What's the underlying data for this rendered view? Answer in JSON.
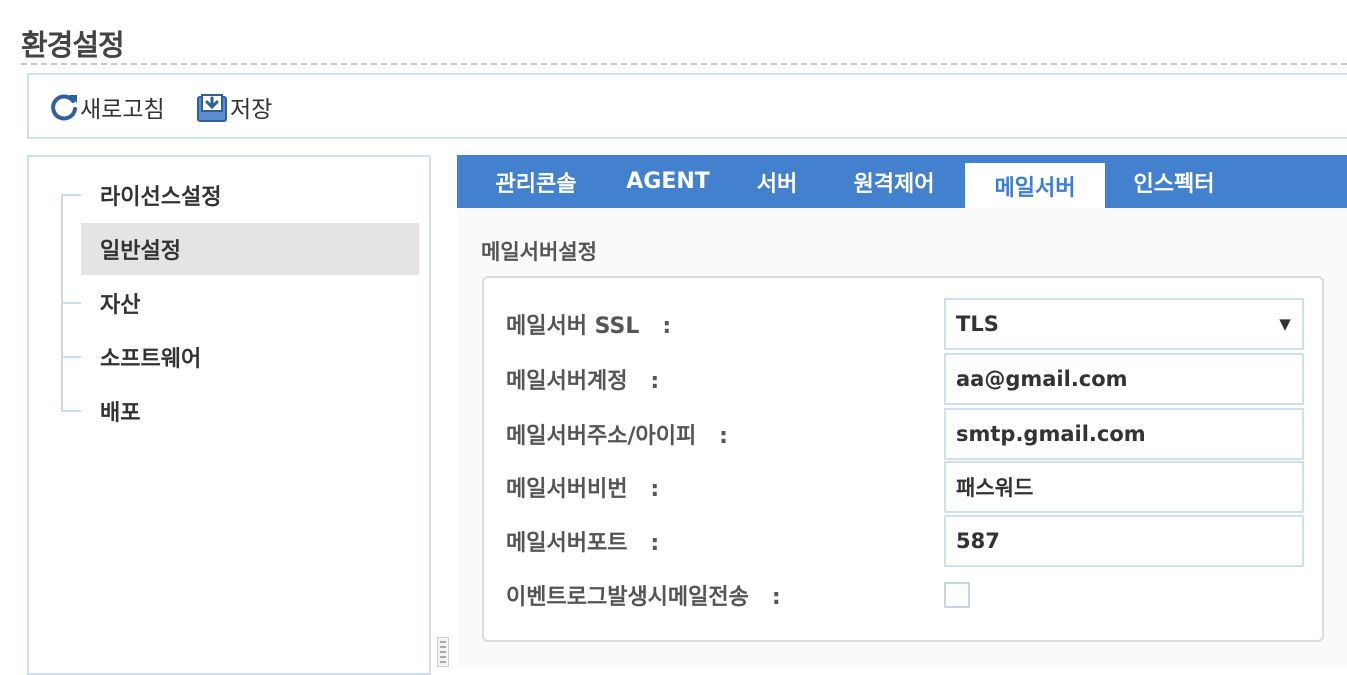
{
  "page": {
    "title": "환경설정"
  },
  "toolbar": {
    "refresh_label": "새로고침",
    "save_label": "저장"
  },
  "sidebar": {
    "items": [
      {
        "label": "라이선스설정",
        "selected": false
      },
      {
        "label": "일반설정",
        "selected": true
      },
      {
        "label": "자산",
        "selected": false
      },
      {
        "label": "소프트웨어",
        "selected": false
      },
      {
        "label": "배포",
        "selected": false
      }
    ]
  },
  "tabs": [
    {
      "label": "관리콘솔",
      "active": false
    },
    {
      "label": "AGENT",
      "active": false
    },
    {
      "label": "서버",
      "active": false
    },
    {
      "label": "원격제어",
      "active": false
    },
    {
      "label": "메일서버",
      "active": true
    },
    {
      "label": "인스펙터",
      "active": false
    }
  ],
  "mail": {
    "section_title": "메일서버설정",
    "ssl": {
      "label": "메일서버 SSL   :",
      "value": "TLS"
    },
    "account": {
      "label": "메일서버계정   :",
      "value": "aa@gmail.com"
    },
    "address": {
      "label": "메일서버주소/아이피   :",
      "value": "smtp.gmail.com"
    },
    "password": {
      "label": "메일서버비번   :",
      "value": "패스워드"
    },
    "port": {
      "label": "메일서버포트   :",
      "value": "587"
    },
    "event_mail": {
      "label": "이벤트로그발생시메일전송   :",
      "checked": false
    }
  },
  "colors": {
    "tab_bar": "#4380cd",
    "active_tab_text": "#3b7fd4",
    "border": "#cfe0f3"
  }
}
